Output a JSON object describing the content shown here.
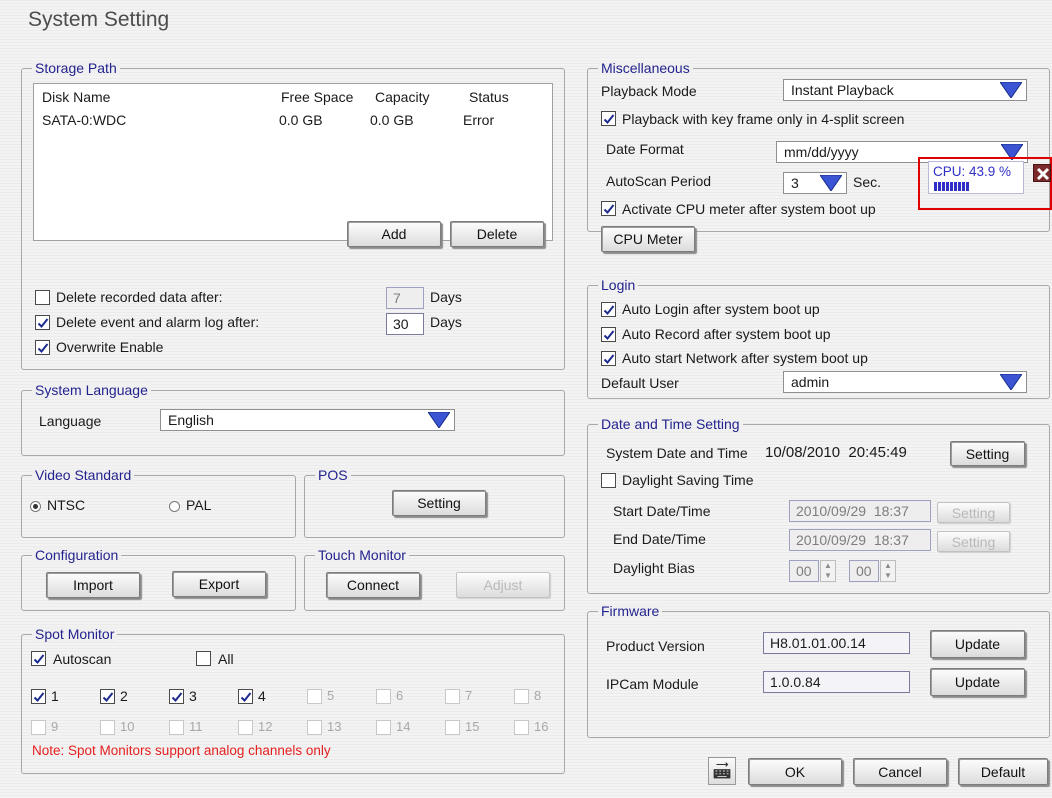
{
  "window": {
    "title": "System Setting"
  },
  "storage": {
    "legend": "Storage Path",
    "columns": [
      "Disk Name",
      "Free Space",
      "Capacity",
      "Status"
    ],
    "rows": [
      [
        "SATA-0:WDC",
        "0.0 GB",
        "0.0 GB",
        "Error"
      ]
    ],
    "add_label": "Add",
    "delete_label": "Delete",
    "delete_recorded_label": "Delete recorded data after:",
    "delete_recorded_value": "7",
    "delete_recorded_checked": false,
    "delete_event_label": "Delete event and alarm log after:",
    "delete_event_value": "30",
    "delete_event_checked": true,
    "days": "Days",
    "overwrite_label": "Overwrite Enable",
    "overwrite_checked": true
  },
  "language": {
    "legend": "System Language",
    "label": "Language",
    "value": "English"
  },
  "video": {
    "legend": "Video Standard",
    "ntsc": "NTSC",
    "pal": "PAL",
    "selected": "NTSC"
  },
  "pos": {
    "legend": "POS",
    "setting_label": "Setting"
  },
  "configuration": {
    "legend": "Configuration",
    "import_label": "Import",
    "export_label": "Export"
  },
  "touch": {
    "legend": "Touch Monitor",
    "connect_label": "Connect",
    "adjust_label": "Adjust"
  },
  "spot": {
    "legend": "Spot Monitor",
    "autoscan_label": "Autoscan",
    "autoscan_checked": true,
    "all_label": "All",
    "all_checked": false,
    "channels": [
      "1",
      "2",
      "3",
      "4",
      "5",
      "6",
      "7",
      "8",
      "9",
      "10",
      "11",
      "12",
      "13",
      "14",
      "15",
      "16"
    ],
    "checked_channels": [
      "1",
      "2",
      "3",
      "4"
    ],
    "note": "Note: Spot Monitors support analog channels only"
  },
  "misc": {
    "legend": "Miscellaneous",
    "playback_mode_label": "Playback Mode",
    "playback_mode_value": "Instant Playback",
    "keyframe_label": "Playback with key frame only in 4-split screen",
    "keyframe_checked": true,
    "date_format_label": "Date Format",
    "date_format_value": "mm/dd/yyyy",
    "autoscan_label": "AutoScan Period",
    "autoscan_value": "3",
    "autoscan_unit": "Sec.",
    "cpu_activate_label": "Activate CPU meter after system boot up",
    "cpu_activate_checked": true,
    "cpu_meter_label": "CPU Meter",
    "cpu_popup_text": "CPU: 43.9 %",
    "cpu_percent": 43.9
  },
  "login": {
    "legend": "Login",
    "auto_login": "Auto Login after system boot up",
    "auto_record": "Auto Record after system boot up",
    "auto_network": "Auto start Network after system boot up",
    "default_user_label": "Default User",
    "default_user_value": "admin"
  },
  "datetime": {
    "legend": "Date and Time Setting",
    "system_label": "System Date and Time",
    "system_value": "10/08/2010  20:45:49",
    "setting_label": "Setting",
    "dst_label": "Daylight Saving Time",
    "dst_checked": false,
    "start_label": "Start Date/Time",
    "start_value": "2010/09/29  18:37",
    "end_label": "End Date/Time",
    "end_value": "2010/09/29  18:37",
    "bias_label": "Daylight Bias",
    "bias_hours": "00",
    "bias_minutes": "00"
  },
  "firmware": {
    "legend": "Firmware",
    "product_label": "Product Version",
    "product_value": "H8.01.01.00.14",
    "ipcam_label": "IPCam Module",
    "ipcam_value": "1.0.0.84",
    "update_label": "Update"
  },
  "footer": {
    "ok_label": "OK",
    "cancel_label": "Cancel",
    "default_label": "Default"
  },
  "colors": {
    "legend": "#23238f",
    "note": "#e52020",
    "highlight": "#e00000",
    "cpu_bar": "#3030c8"
  }
}
